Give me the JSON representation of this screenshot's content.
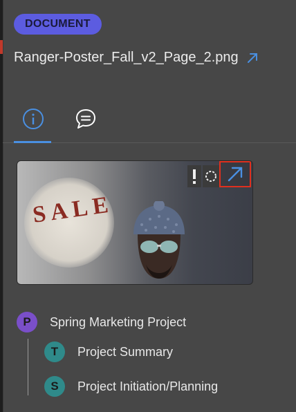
{
  "header": {
    "badge": "DOCUMENT",
    "filename": "Ranger-Poster_Fall_v2_Page_2.png"
  },
  "tabs": [
    {
      "name": "info",
      "active": true
    },
    {
      "name": "comments",
      "active": false
    }
  ],
  "thumbnail": {
    "overlay_text": "SALE"
  },
  "hierarchy": {
    "project": {
      "initial": "P",
      "label": "Spring Marketing Project",
      "color": "#7a4fc9"
    },
    "children": [
      {
        "initial": "T",
        "label": "Project Summary",
        "color": "#2f8a8a"
      },
      {
        "initial": "S",
        "label": "Project Initiation/Planning",
        "color": "#2f8a8a"
      }
    ]
  },
  "colors": {
    "accent": "#4a90e2",
    "badge": "#5c5ce0",
    "highlight": "#e0301e"
  }
}
